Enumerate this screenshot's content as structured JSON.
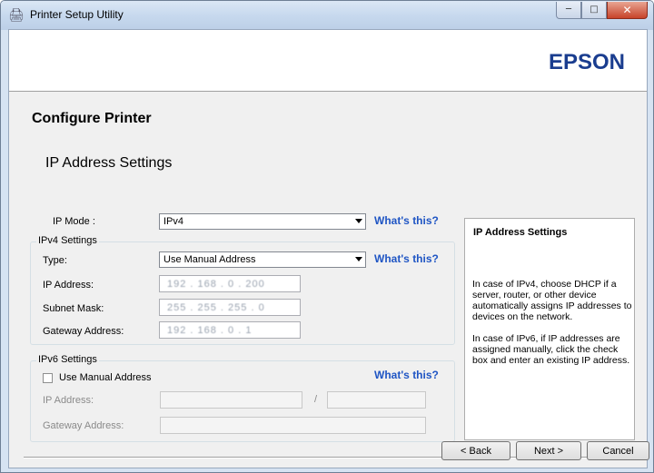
{
  "window": {
    "title": "Printer Setup Utility",
    "min_glyph": "─",
    "max_glyph": "□",
    "close_glyph": "✕"
  },
  "banner": {
    "brand": "EPSON"
  },
  "page": {
    "title": "Configure Printer",
    "section_title": "IP Address Settings"
  },
  "ip_mode": {
    "label": "IP Mode :",
    "value": "IPv4",
    "help": "What's this?"
  },
  "ipv4": {
    "group_title": "IPv4 Settings",
    "type_label": "Type:",
    "type_value": "Use Manual Address",
    "type_help": "What's this?",
    "ip_label": "IP Address:",
    "ip_value": "192 . 168 . 0 . 200",
    "subnet_label": "Subnet Mask:",
    "subnet_value": "255 . 255 . 255 . 0",
    "gateway_label": "Gateway Address:",
    "gateway_value": "192 . 168 . 0 . 1"
  },
  "ipv6": {
    "group_title": "IPv6 Settings",
    "manual_label": "Use Manual Address",
    "manual_checked": false,
    "help": "What's this?",
    "ip_label": "IP Address:",
    "separator": "/",
    "gateway_label": "Gateway Address:"
  },
  "info": {
    "title": "IP Address Settings",
    "p1": "In case of IPv4, choose DHCP if a server, router, or other device automatically assigns IP addresses to devices on the network.",
    "p2": "In case of IPv6, if IP addresses are assigned manually, click the check box and enter an existing IP address."
  },
  "buttons": {
    "back": "< Back",
    "next": "Next >",
    "cancel": "Cancel"
  }
}
